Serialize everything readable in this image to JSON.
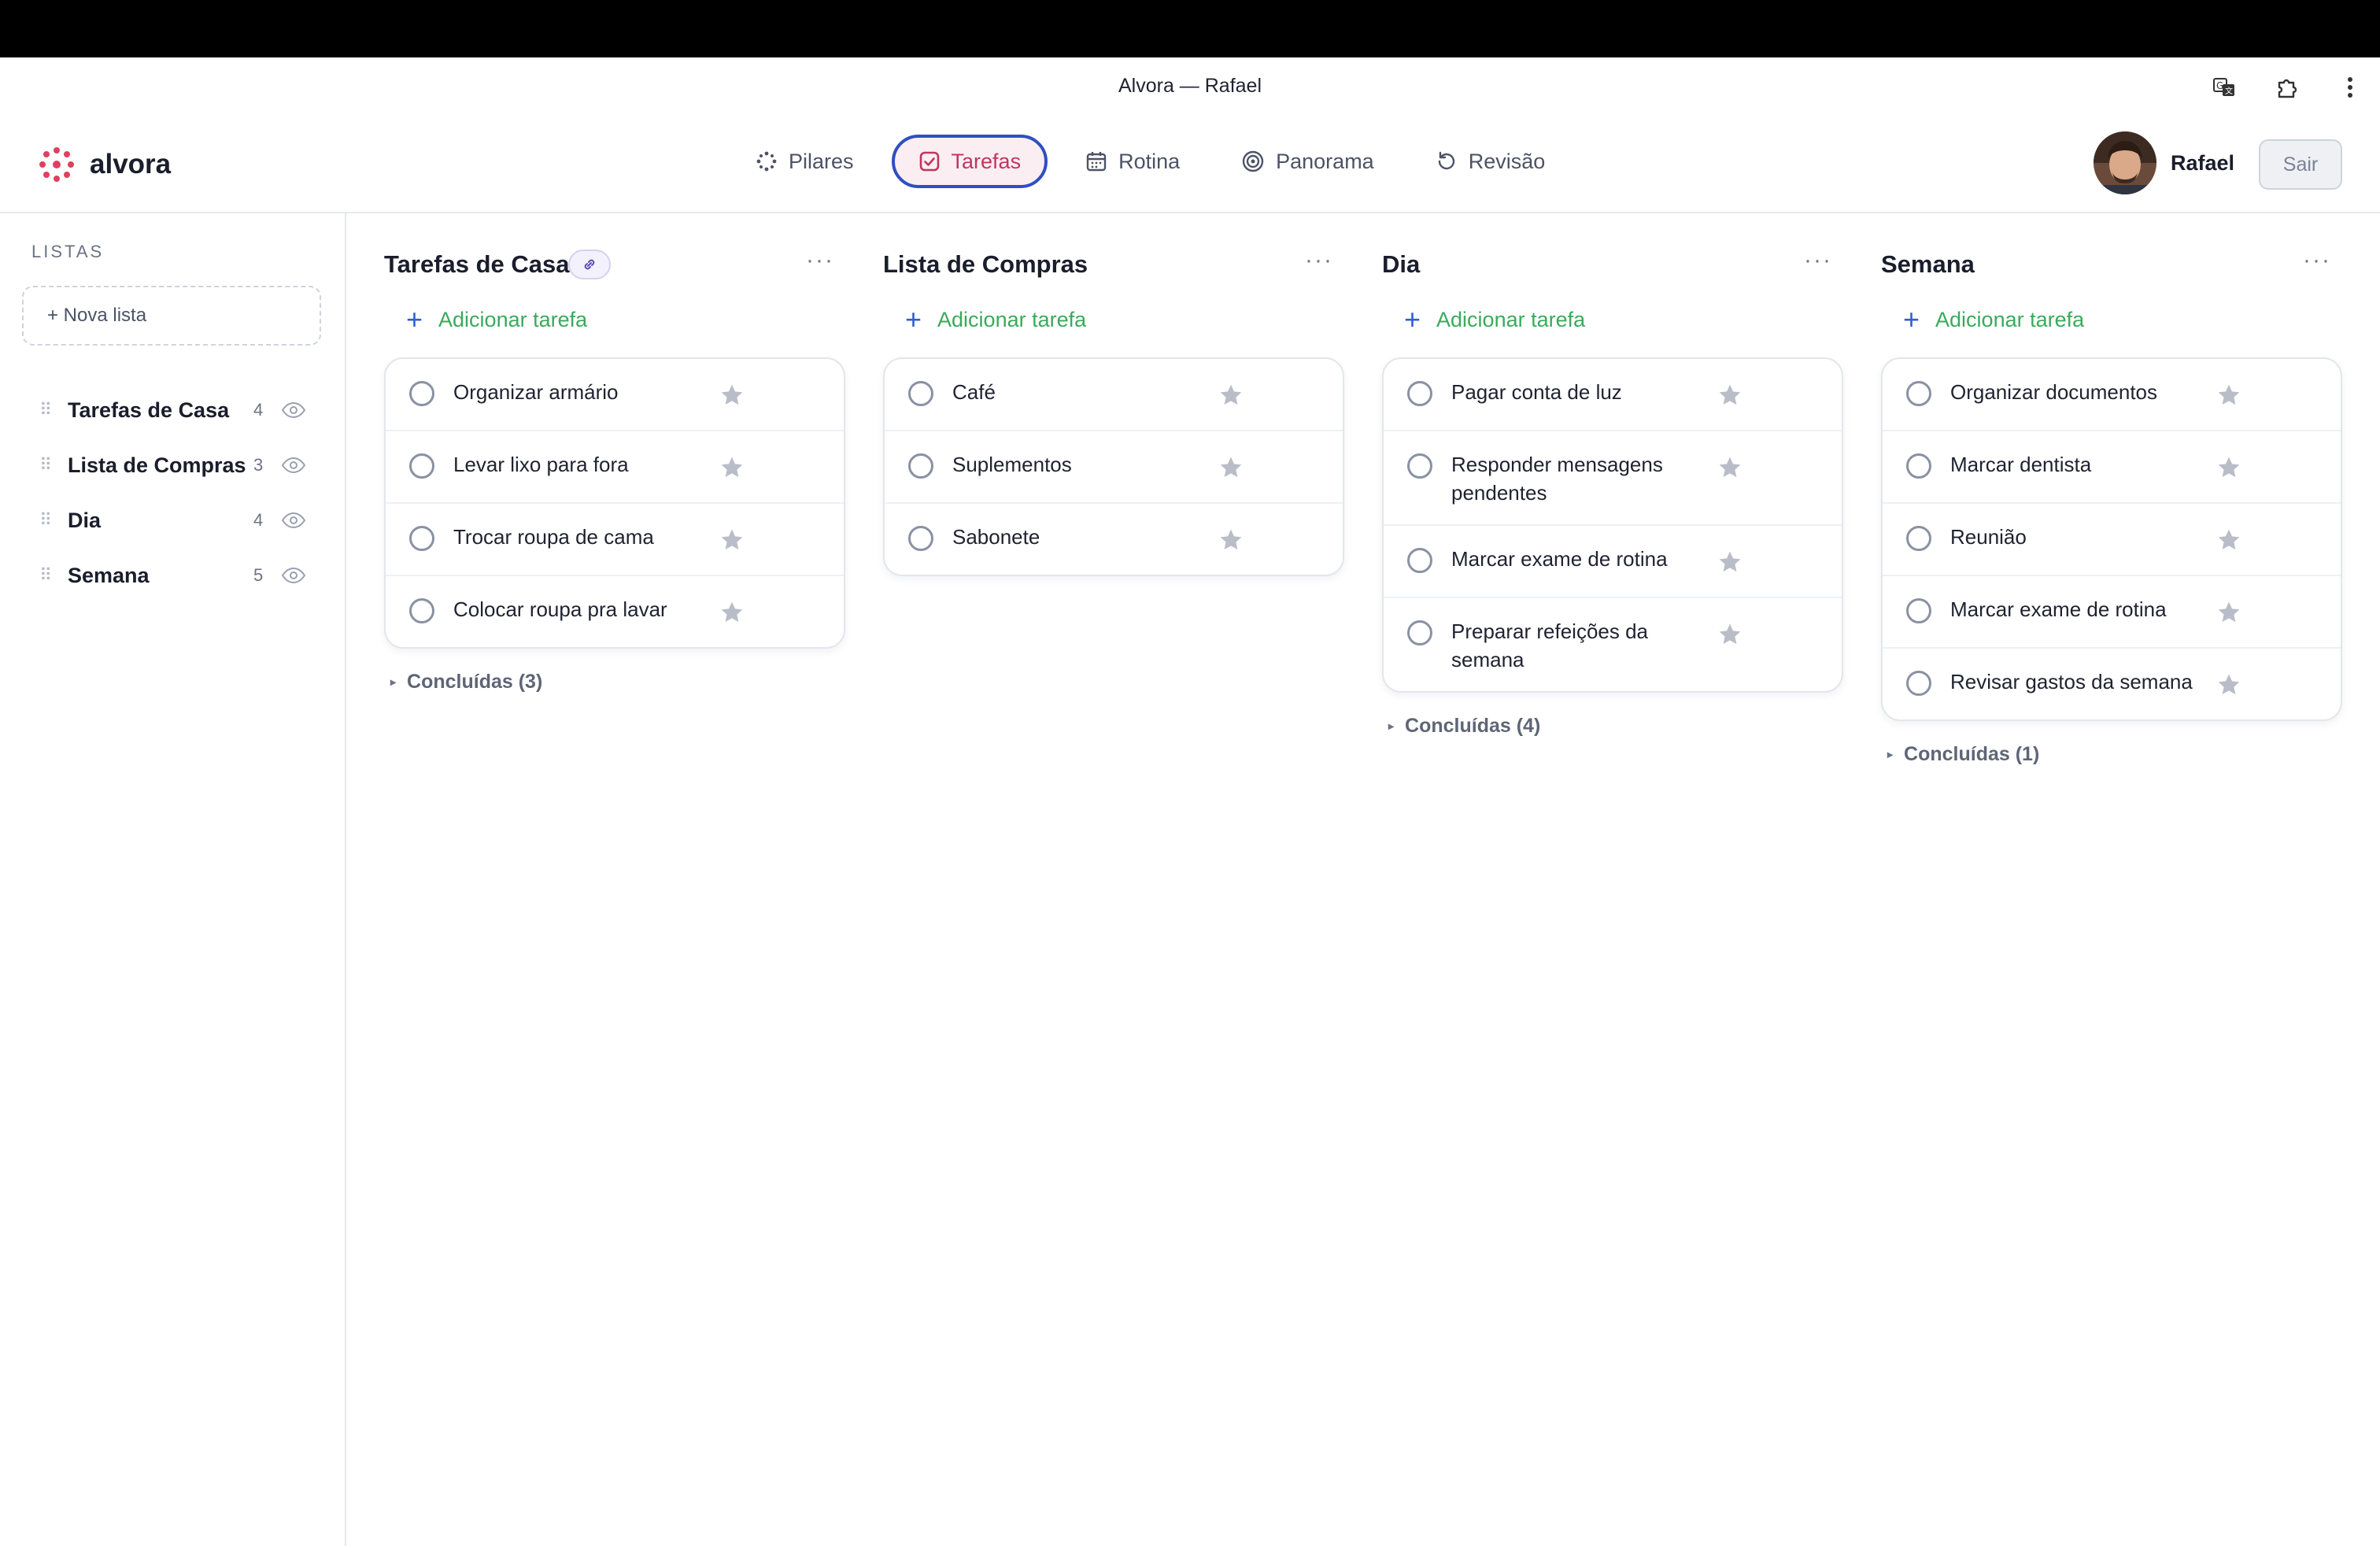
{
  "window": {
    "title": "Alvora — Rafael"
  },
  "brand": {
    "name": "alvora",
    "accent": "#e0405f"
  },
  "nav": [
    {
      "label": "Pilares",
      "icon": "dots-icon",
      "active": false
    },
    {
      "label": "Tarefas",
      "icon": "checkbox-icon",
      "active": true
    },
    {
      "label": "Rotina",
      "icon": "calendar-icon",
      "active": false
    },
    {
      "label": "Panorama",
      "icon": "target-icon",
      "active": false
    },
    {
      "label": "Revisão",
      "icon": "refresh-icon",
      "active": false
    }
  ],
  "user": {
    "name": "Rafael",
    "logout_label": "Sair"
  },
  "sidebar": {
    "title": "LISTAS",
    "new_list_label": "+ Nova lista",
    "lists": [
      {
        "name": "Tarefas de Casa",
        "count": "4"
      },
      {
        "name": "Lista de Compras",
        "count": "3"
      },
      {
        "name": "Dia",
        "count": "4"
      },
      {
        "name": "Semana",
        "count": "5"
      }
    ]
  },
  "columns": [
    {
      "title": "Tarefas de Casa",
      "add_label": "Adicionar tarefa",
      "tasks": [
        "Organizar armário",
        "Levar lixo para fora",
        "Trocar roupa de cama",
        "Colocar roupa pra lavar"
      ],
      "done_label": "Concluídas (3)"
    },
    {
      "title": "Lista de Compras",
      "add_label": "Adicionar tarefa",
      "tasks": [
        "Café",
        "Suplementos",
        "Sabonete"
      ],
      "done_label": ""
    },
    {
      "title": "Dia",
      "add_label": "Adicionar tarefa",
      "tasks": [
        "Pagar conta de luz",
        "Responder mensagens pendentes",
        "Marcar exame de rotina",
        "Preparar refeições da semana"
      ],
      "done_label": "Concluídas (4)"
    },
    {
      "title": "Semana",
      "add_label": "Adicionar tarefa",
      "tasks": [
        "Organizar documentos",
        "Marcar dentista",
        "Reunião",
        "Marcar exame de rotina",
        "Revisar gastos da semana"
      ],
      "done_label": "Concluídas (1)"
    }
  ]
}
